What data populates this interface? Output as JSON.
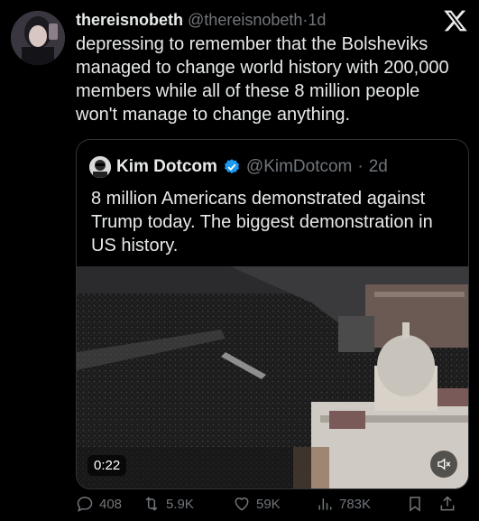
{
  "tweet": {
    "display_name": "thereisnobeth",
    "handle": "@thereisnobeth",
    "separator": "·",
    "age": "1d",
    "text": "depressing to remember that the Bolsheviks managed to change world history with 200,000 members while all of these 8 million people won't manage to change anything."
  },
  "quoted": {
    "display_name": "Kim Dotcom",
    "handle": "@KimDotcom",
    "separator": "·",
    "age": "2d",
    "text": "8 million Americans demonstrated against Trump today. The biggest demonstration in US history.",
    "video_duration": "0:22"
  },
  "actions": {
    "replies": "408",
    "retweets": "5.9K",
    "likes": "59K",
    "views": "783K"
  },
  "icons": {
    "x_logo": "x-logo-icon",
    "verified": "verified-badge-icon",
    "reply": "reply-icon",
    "retweet": "retweet-icon",
    "like": "heart-icon",
    "views": "views-chart-icon",
    "bookmark": "bookmark-icon",
    "share": "share-icon",
    "mute": "mute-icon"
  },
  "colors": {
    "background": "#000000",
    "text": "#e7e9ea",
    "muted": "#71767b",
    "verified": "#1d9bf0"
  }
}
